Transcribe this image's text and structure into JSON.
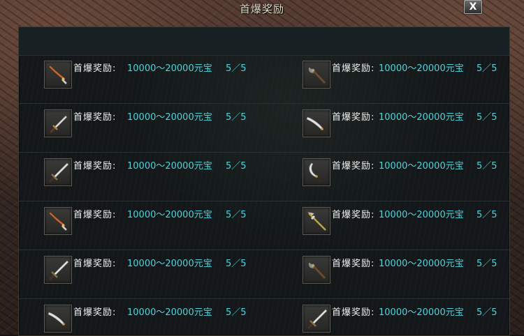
{
  "window": {
    "title": "首爆奖励",
    "close_label": "X"
  },
  "rows": [
    {
      "left": {
        "icon": "saber-icon",
        "label": "首爆奖励:",
        "amount": "10000～20000元宝",
        "count": "5／5"
      },
      "right": {
        "icon": "axe-icon",
        "label": "首爆奖励:",
        "amount": "10000～20000元宝",
        "count": "5／5"
      }
    },
    {
      "left": {
        "icon": "dagger-icon",
        "label": "首爆奖励:",
        "amount": "10000～20000元宝",
        "count": "5／5"
      },
      "right": {
        "icon": "scimitar-icon",
        "label": "首爆奖励:",
        "amount": "10000～20000元宝",
        "count": "5／5"
      }
    },
    {
      "left": {
        "icon": "sword-icon",
        "label": "首爆奖励:",
        "amount": "10000～20000元宝",
        "count": "5／5"
      },
      "right": {
        "icon": "curved-blade-icon",
        "label": "首爆奖励:",
        "amount": "10000～20000元宝",
        "count": "5／5"
      }
    },
    {
      "left": {
        "icon": "saber-icon",
        "label": "首爆奖励:",
        "amount": "10000～20000元宝",
        "count": "5／5"
      },
      "right": {
        "icon": "halberd-icon",
        "label": "首爆奖励:",
        "amount": "10000～20000元宝",
        "count": "5／5"
      }
    },
    {
      "left": {
        "icon": "sword-icon",
        "label": "首爆奖励:",
        "amount": "10000～20000元宝",
        "count": "5／5"
      },
      "right": {
        "icon": "axe-icon",
        "label": "首爆奖励:",
        "amount": "10000～20000元宝",
        "count": "5／5"
      }
    },
    {
      "left": {
        "icon": "scimitar-icon",
        "label": "首爆奖励:",
        "amount": "10000～20000元宝",
        "count": "5／5"
      },
      "right": {
        "icon": "sword-icon",
        "label": "首爆奖励:",
        "amount": "10000～20000元宝",
        "count": "5／5"
      }
    }
  ],
  "colors": {
    "label": "#f1f1f1",
    "value": "#4fd4dc",
    "panel": "#131719"
  }
}
